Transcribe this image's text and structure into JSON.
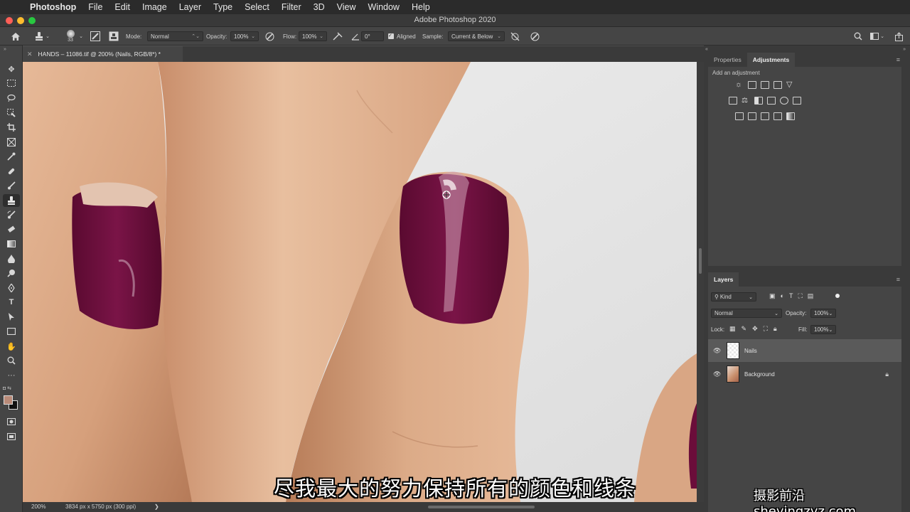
{
  "menubar": {
    "app_name": "Photoshop",
    "items": [
      "File",
      "Edit",
      "Image",
      "Layer",
      "Type",
      "Select",
      "Filter",
      "3D",
      "View",
      "Window",
      "Help"
    ]
  },
  "window": {
    "title": "Adobe Photoshop 2020"
  },
  "options_bar": {
    "brush_size": "33",
    "mode_label": "Mode:",
    "mode_value": "Normal",
    "opacity_label": "Opacity:",
    "opacity_value": "100%",
    "flow_label": "Flow:",
    "flow_value": "100%",
    "angle_value": "0°",
    "aligned_label": "Aligned",
    "aligned_checked": true,
    "sample_label": "Sample:",
    "sample_value": "Current & Below"
  },
  "document": {
    "tab_title": "HANDS – 11086.tif @ 200% (Nails, RGB/8*) *"
  },
  "status_bar": {
    "zoom": "200%",
    "doc_info": "3834 px x 5750 px (300 ppi)",
    "arrow": "❯"
  },
  "properties_panel": {
    "tabs": [
      "Properties",
      "Adjustments"
    ],
    "active_tab": "Adjustments",
    "add_label": "Add an adjustment"
  },
  "layers_panel": {
    "title": "Layers",
    "filter_kind": "Kind",
    "blend_mode": "Normal",
    "opacity_label": "Opacity:",
    "opacity_value": "100%",
    "lock_label": "Lock:",
    "fill_label": "Fill:",
    "fill_value": "100%",
    "layers": [
      {
        "name": "Nails",
        "selected": true,
        "locked": false
      },
      {
        "name": "Background",
        "selected": false,
        "locked": true
      }
    ]
  },
  "colors": {
    "foreground": "#b98a78",
    "background": "#111111",
    "nail_polish": "#6b0d3a"
  },
  "overlay": {
    "subtitle": "尽我最大的努力保持所有的颜色和线条",
    "watermark": "摄影前沿 sheyingzyz.com"
  }
}
